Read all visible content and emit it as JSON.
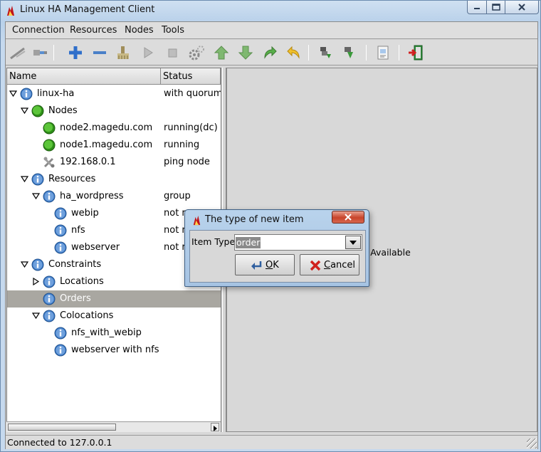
{
  "window": {
    "title": "Linux HA Management Client",
    "app_icon": "heartbeat-flame-icon",
    "controls": {
      "minimize": "minimize-icon",
      "maximize": "maximize-icon",
      "close": "close-icon"
    }
  },
  "menubar": {
    "items": [
      {
        "label": "Connection"
      },
      {
        "label": "Resources"
      },
      {
        "label": "Nodes"
      },
      {
        "label": "Tools"
      }
    ]
  },
  "toolbar": {
    "buttons": [
      {
        "icon": "connect-icon"
      },
      {
        "icon": "disconnect-icon"
      },
      {
        "icon": "add-icon"
      },
      {
        "icon": "remove-icon"
      },
      {
        "icon": "cleanup-icon"
      },
      {
        "icon": "start-icon"
      },
      {
        "icon": "stop-icon"
      },
      {
        "icon": "default-settings-icon"
      },
      {
        "icon": "move-up-icon"
      },
      {
        "icon": "move-down-icon"
      },
      {
        "icon": "migrate-icon"
      },
      {
        "icon": "unmigrate-icon"
      },
      {
        "icon": "standby-icon"
      },
      {
        "icon": "active-icon"
      },
      {
        "icon": "view-xml-icon"
      },
      {
        "icon": "exit-icon"
      }
    ]
  },
  "tree": {
    "columns": {
      "name": "Name",
      "status": "Status"
    },
    "rows": [
      {
        "label": "linux-ha",
        "status": "with quorum",
        "icon": "info-icon",
        "toggle": "expanded"
      },
      {
        "label": "Nodes",
        "status": "",
        "icon": "node-group-icon",
        "toggle": "expanded"
      },
      {
        "label": "node2.magedu.com",
        "status": "running(dc)",
        "icon": "node-running-icon",
        "toggle": "none"
      },
      {
        "label": "node1.magedu.com",
        "status": "running",
        "icon": "node-running-icon",
        "toggle": "none"
      },
      {
        "label": "192.168.0.1",
        "status": "ping node",
        "icon": "ping-node-icon",
        "toggle": "none"
      },
      {
        "label": "Resources",
        "status": "",
        "icon": "info-icon",
        "toggle": "expanded"
      },
      {
        "label": "ha_wordpress",
        "status": "group",
        "icon": "info-icon",
        "toggle": "expanded"
      },
      {
        "label": "webip",
        "status": "not ru",
        "icon": "info-icon",
        "toggle": "none"
      },
      {
        "label": "nfs",
        "status": "not ru",
        "icon": "info-icon",
        "toggle": "none"
      },
      {
        "label": "webserver",
        "status": "not ru",
        "icon": "info-icon",
        "toggle": "none"
      },
      {
        "label": "Constraints",
        "status": "",
        "icon": "info-icon",
        "toggle": "expanded"
      },
      {
        "label": "Locations",
        "status": "",
        "icon": "info-icon",
        "toggle": "collapsed"
      },
      {
        "label": "Orders",
        "status": "",
        "icon": "info-icon",
        "toggle": "none",
        "selected": true
      },
      {
        "label": "Colocations",
        "status": "",
        "icon": "info-icon",
        "toggle": "expanded"
      },
      {
        "label": "nfs_with_webip",
        "status": "",
        "icon": "info-icon",
        "toggle": "none"
      },
      {
        "label": "webserver with nfs",
        "status": "",
        "icon": "info-icon",
        "toggle": "none"
      }
    ]
  },
  "right_pane": {
    "message": "No Data Available",
    "visible_fragment": "ata Available"
  },
  "dialog": {
    "title": "The type of new item",
    "item_type_label": "Item Type:",
    "item_type_value": "order",
    "ok_label": "OK",
    "cancel_label": "Cancel"
  },
  "status_bar": {
    "text": "Connected to 127.0.0.1"
  },
  "colors": {
    "title_bar": "#c6d9ee",
    "selection": "#a9a7a1",
    "node_running": "#3fae1f",
    "info_blue": "#3a79c8"
  }
}
